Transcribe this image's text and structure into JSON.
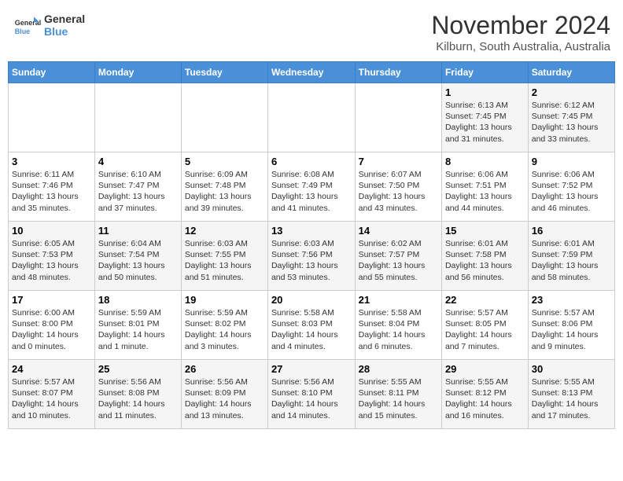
{
  "header": {
    "logo_line1": "General",
    "logo_line2": "Blue",
    "month": "November 2024",
    "location": "Kilburn, South Australia, Australia"
  },
  "days_of_week": [
    "Sunday",
    "Monday",
    "Tuesday",
    "Wednesday",
    "Thursday",
    "Friday",
    "Saturday"
  ],
  "weeks": [
    [
      {
        "day": "",
        "info": ""
      },
      {
        "day": "",
        "info": ""
      },
      {
        "day": "",
        "info": ""
      },
      {
        "day": "",
        "info": ""
      },
      {
        "day": "",
        "info": ""
      },
      {
        "day": "1",
        "info": "Sunrise: 6:13 AM\nSunset: 7:45 PM\nDaylight: 13 hours\nand 31 minutes."
      },
      {
        "day": "2",
        "info": "Sunrise: 6:12 AM\nSunset: 7:45 PM\nDaylight: 13 hours\nand 33 minutes."
      }
    ],
    [
      {
        "day": "3",
        "info": "Sunrise: 6:11 AM\nSunset: 7:46 PM\nDaylight: 13 hours\nand 35 minutes."
      },
      {
        "day": "4",
        "info": "Sunrise: 6:10 AM\nSunset: 7:47 PM\nDaylight: 13 hours\nand 37 minutes."
      },
      {
        "day": "5",
        "info": "Sunrise: 6:09 AM\nSunset: 7:48 PM\nDaylight: 13 hours\nand 39 minutes."
      },
      {
        "day": "6",
        "info": "Sunrise: 6:08 AM\nSunset: 7:49 PM\nDaylight: 13 hours\nand 41 minutes."
      },
      {
        "day": "7",
        "info": "Sunrise: 6:07 AM\nSunset: 7:50 PM\nDaylight: 13 hours\nand 43 minutes."
      },
      {
        "day": "8",
        "info": "Sunrise: 6:06 AM\nSunset: 7:51 PM\nDaylight: 13 hours\nand 44 minutes."
      },
      {
        "day": "9",
        "info": "Sunrise: 6:06 AM\nSunset: 7:52 PM\nDaylight: 13 hours\nand 46 minutes."
      }
    ],
    [
      {
        "day": "10",
        "info": "Sunrise: 6:05 AM\nSunset: 7:53 PM\nDaylight: 13 hours\nand 48 minutes."
      },
      {
        "day": "11",
        "info": "Sunrise: 6:04 AM\nSunset: 7:54 PM\nDaylight: 13 hours\nand 50 minutes."
      },
      {
        "day": "12",
        "info": "Sunrise: 6:03 AM\nSunset: 7:55 PM\nDaylight: 13 hours\nand 51 minutes."
      },
      {
        "day": "13",
        "info": "Sunrise: 6:03 AM\nSunset: 7:56 PM\nDaylight: 13 hours\nand 53 minutes."
      },
      {
        "day": "14",
        "info": "Sunrise: 6:02 AM\nSunset: 7:57 PM\nDaylight: 13 hours\nand 55 minutes."
      },
      {
        "day": "15",
        "info": "Sunrise: 6:01 AM\nSunset: 7:58 PM\nDaylight: 13 hours\nand 56 minutes."
      },
      {
        "day": "16",
        "info": "Sunrise: 6:01 AM\nSunset: 7:59 PM\nDaylight: 13 hours\nand 58 minutes."
      }
    ],
    [
      {
        "day": "17",
        "info": "Sunrise: 6:00 AM\nSunset: 8:00 PM\nDaylight: 14 hours\nand 0 minutes."
      },
      {
        "day": "18",
        "info": "Sunrise: 5:59 AM\nSunset: 8:01 PM\nDaylight: 14 hours\nand 1 minute."
      },
      {
        "day": "19",
        "info": "Sunrise: 5:59 AM\nSunset: 8:02 PM\nDaylight: 14 hours\nand 3 minutes."
      },
      {
        "day": "20",
        "info": "Sunrise: 5:58 AM\nSunset: 8:03 PM\nDaylight: 14 hours\nand 4 minutes."
      },
      {
        "day": "21",
        "info": "Sunrise: 5:58 AM\nSunset: 8:04 PM\nDaylight: 14 hours\nand 6 minutes."
      },
      {
        "day": "22",
        "info": "Sunrise: 5:57 AM\nSunset: 8:05 PM\nDaylight: 14 hours\nand 7 minutes."
      },
      {
        "day": "23",
        "info": "Sunrise: 5:57 AM\nSunset: 8:06 PM\nDaylight: 14 hours\nand 9 minutes."
      }
    ],
    [
      {
        "day": "24",
        "info": "Sunrise: 5:57 AM\nSunset: 8:07 PM\nDaylight: 14 hours\nand 10 minutes."
      },
      {
        "day": "25",
        "info": "Sunrise: 5:56 AM\nSunset: 8:08 PM\nDaylight: 14 hours\nand 11 minutes."
      },
      {
        "day": "26",
        "info": "Sunrise: 5:56 AM\nSunset: 8:09 PM\nDaylight: 14 hours\nand 13 minutes."
      },
      {
        "day": "27",
        "info": "Sunrise: 5:56 AM\nSunset: 8:10 PM\nDaylight: 14 hours\nand 14 minutes."
      },
      {
        "day": "28",
        "info": "Sunrise: 5:55 AM\nSunset: 8:11 PM\nDaylight: 14 hours\nand 15 minutes."
      },
      {
        "day": "29",
        "info": "Sunrise: 5:55 AM\nSunset: 8:12 PM\nDaylight: 14 hours\nand 16 minutes."
      },
      {
        "day": "30",
        "info": "Sunrise: 5:55 AM\nSunset: 8:13 PM\nDaylight: 14 hours\nand 17 minutes."
      }
    ]
  ]
}
